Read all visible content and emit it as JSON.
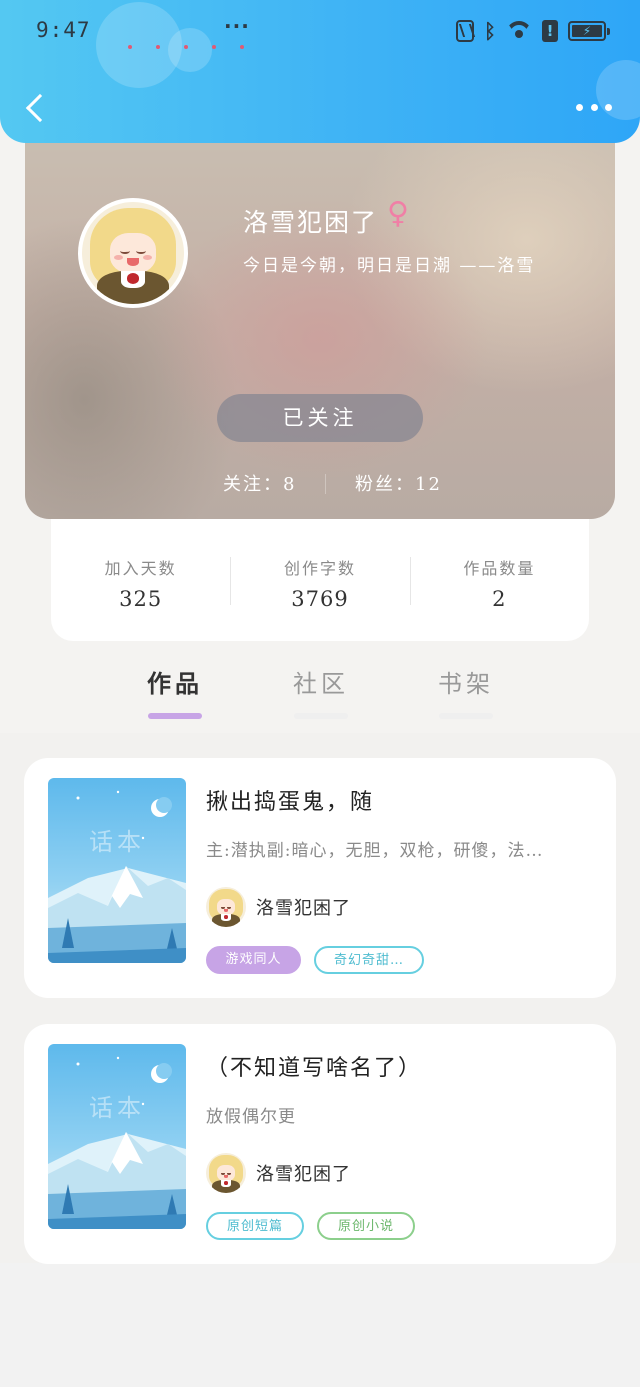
{
  "status_bar": {
    "time": "9:47",
    "more": "···",
    "alert_glyph": "!",
    "icons": [
      "nfc-icon",
      "bluetooth-icon",
      "wifi-icon",
      "alert-icon",
      "battery-charging-icon"
    ]
  },
  "nav": {
    "back_icon": "back-arrow-icon",
    "more_icon": "more-dots-icon"
  },
  "profile": {
    "nickname": "洛雪犯困了",
    "gender_symbol": "♀",
    "signature": "今日是今朝，明日是日潮  ——洛雪",
    "follow_button": "已关注",
    "following": "关注：8",
    "fans": "粉丝：12"
  },
  "stats": [
    {
      "label": "加入天数",
      "value": "325"
    },
    {
      "label": "创作字数",
      "value": "3769"
    },
    {
      "label": "作品数量",
      "value": "2"
    }
  ],
  "tabs": [
    {
      "label": "作品",
      "active": true
    },
    {
      "label": "社区",
      "active": false
    },
    {
      "label": "书架",
      "active": false
    }
  ],
  "works": [
    {
      "cover_text": "话本",
      "title": "揪出捣蛋鬼，随",
      "description": "主:潜执副:暗心，无胆，双枪，研傻，法…",
      "author": "洛雪犯困了",
      "tags": [
        "游戏同人",
        "奇幻奇甜…"
      ]
    },
    {
      "cover_text": "话本",
      "title": "（不知道写啥名了）",
      "description": "放假偶尔更",
      "author": "洛雪犯困了",
      "tags": [
        "原创短篇",
        "原创小说"
      ]
    }
  ],
  "colors": {
    "topbar": "#3fb3f5",
    "tab_active": "#c7a4e6",
    "tag_purple": "#c7a4e6",
    "tag_cyan": "#66cfe0",
    "tag_green": "#8ccf8c",
    "gender": "#f07fa6"
  }
}
